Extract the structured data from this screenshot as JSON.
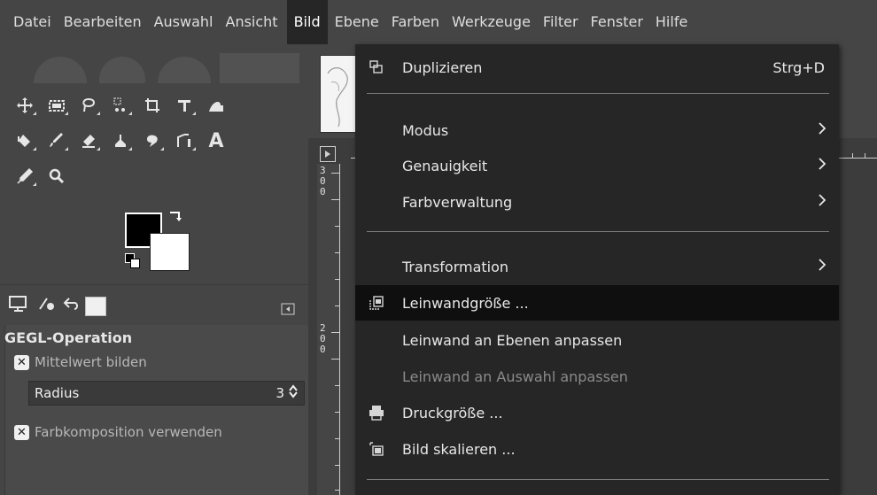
{
  "menubar": {
    "items": [
      "Datei",
      "Bearbeiten",
      "Auswahl",
      "Ansicht",
      "Bild",
      "Ebene",
      "Farben",
      "Werkzeuge",
      "Filter",
      "Fenster",
      "Hilfe"
    ],
    "active": "Bild"
  },
  "toolbox": {
    "icons": {
      "row1": [
        "move-tool-icon",
        "rect-select-icon",
        "free-select-icon",
        "fuzzy-select-icon",
        "crop-icon",
        "unified-transform-icon",
        "warp-icon"
      ],
      "row2": [
        "bucket-fill-icon",
        "paintbrush-icon",
        "eraser-icon",
        "clone-icon",
        "smudge-icon",
        "path-icon",
        "text-icon"
      ],
      "row3": [
        "color-picker-icon",
        "zoom-icon"
      ]
    },
    "text_tool_glyph": "A",
    "foreground_color": "#000000",
    "background_color": "#ffffff"
  },
  "tool_options": {
    "title": "GEGL-Operation",
    "checkbox_average": "Mittelwert bilden",
    "radius_label": "Radius",
    "radius_value": "3",
    "checkbox_composite": "Farbkomposition verwenden",
    "check_glyph": "✕"
  },
  "rulers": {
    "vertical_labels": [
      "3",
      "0",
      "0",
      "2",
      "0",
      "0"
    ]
  },
  "bild_menu": {
    "items": [
      {
        "label": "Duplizieren",
        "shortcut": "Strg+D",
        "icon": "duplicate-icon"
      },
      {
        "label": "Modus",
        "submenu": true
      },
      {
        "label": "Genauigkeit",
        "submenu": true
      },
      {
        "label": "Farbverwaltung",
        "submenu": true
      },
      {
        "label": "Transformation",
        "submenu": true
      },
      {
        "label": "Leinwandgröße ...",
        "icon": "canvas-size-icon",
        "highlighted": true
      },
      {
        "label": "Leinwand an Ebenen anpassen"
      },
      {
        "label": "Leinwand an Auswahl anpassen",
        "disabled": true
      },
      {
        "label": "Druckgröße ...",
        "icon": "print-size-icon"
      },
      {
        "label": "Bild skalieren ...",
        "icon": "scale-image-icon"
      }
    ],
    "submenu_arrow": "›"
  }
}
